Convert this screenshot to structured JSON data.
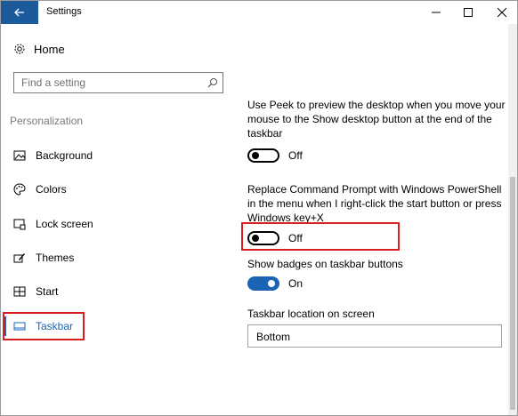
{
  "window": {
    "title": "Settings"
  },
  "sidebar": {
    "home_label": "Home",
    "search": {
      "placeholder": "Find a setting",
      "value": ""
    },
    "section_title": "Personalization",
    "items": [
      {
        "label": "Background",
        "icon": "picture-icon"
      },
      {
        "label": "Colors",
        "icon": "palette-icon"
      },
      {
        "label": "Lock screen",
        "icon": "lock-screen-icon"
      },
      {
        "label": "Themes",
        "icon": "paintbrush-icon"
      },
      {
        "label": "Start",
        "icon": "start-grid-icon"
      },
      {
        "label": "Taskbar",
        "icon": "taskbar-icon",
        "active": true
      }
    ]
  },
  "main": {
    "peek": {
      "description": "Use Peek to preview the desktop when you move your mouse to the Show desktop button at the end of the taskbar",
      "state": "Off"
    },
    "powershell": {
      "description": "Replace Command Prompt with Windows PowerShell in the menu when I right-click the start button or press Windows key+X",
      "state": "Off"
    },
    "badges": {
      "description": "Show badges on taskbar buttons",
      "state": "On"
    },
    "location": {
      "label": "Taskbar location on screen",
      "value": "Bottom"
    }
  },
  "colors": {
    "accent": "#1a63b5",
    "titlebar_back": "#1b5a9b",
    "highlight": "#d81e1e"
  }
}
